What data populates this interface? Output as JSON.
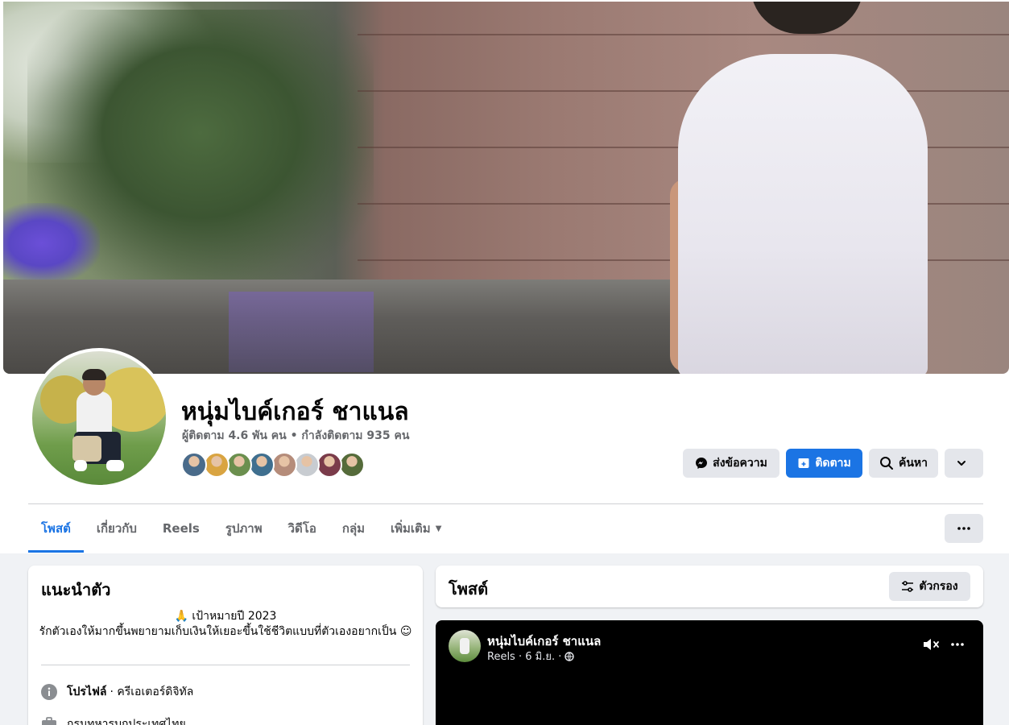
{
  "profile": {
    "name": "หนุ่มไบค์เกอร์ ชาแนล",
    "followers_text": "ผู้ติดตาม 4.6 พัน คน • กำลังติดตาม 935 คน",
    "mutual_friend_colors": [
      "#4a6b8a",
      "#d9a441",
      "#6b8f4e",
      "#3f6f8f",
      "#b58c7a",
      "#c8ccd1",
      "#7a3b4a",
      "#556b3a"
    ]
  },
  "actions": {
    "message_label": "ส่งข้อความ",
    "follow_label": "ติดตาม",
    "search_label": "ค้นหา"
  },
  "tabs": [
    {
      "label": "โพสต์"
    },
    {
      "label": "เกี่ยวกับ"
    },
    {
      "label": "Reels"
    },
    {
      "label": "รูปภาพ"
    },
    {
      "label": "วิดีโอ"
    },
    {
      "label": "กลุ่ม"
    },
    {
      "label": "เพิ่มเติม"
    }
  ],
  "intro": {
    "title": "แนะนำตัว",
    "bio_line1": "🙏 เป้าหมายปี 2023",
    "bio_line2": "รักตัวเองให้มากขึ้นพยายามเก็บเงินให้เยอะขึ้นใช้ชีวิตแบบที่ตัวเองอยากเป็น ☺",
    "profile_label": "โปรไฟล์",
    "profile_value": "· ครีเอเตอร์ดิจิทัล",
    "work_text": "กรมทหารบกประเทศไทย"
  },
  "posts": {
    "title": "โพสต์",
    "filter_label": "ตัวกรอง",
    "reel": {
      "author": "หนุ่มไบค์เกอร์ ชาแนล",
      "meta": "Reels · 6 มิ.ย. ·"
    }
  },
  "colors": {
    "accent": "#1b74e4",
    "button_gray": "#e4e6eb",
    "text_secondary": "#65676b",
    "background": "#f0f2f5"
  }
}
